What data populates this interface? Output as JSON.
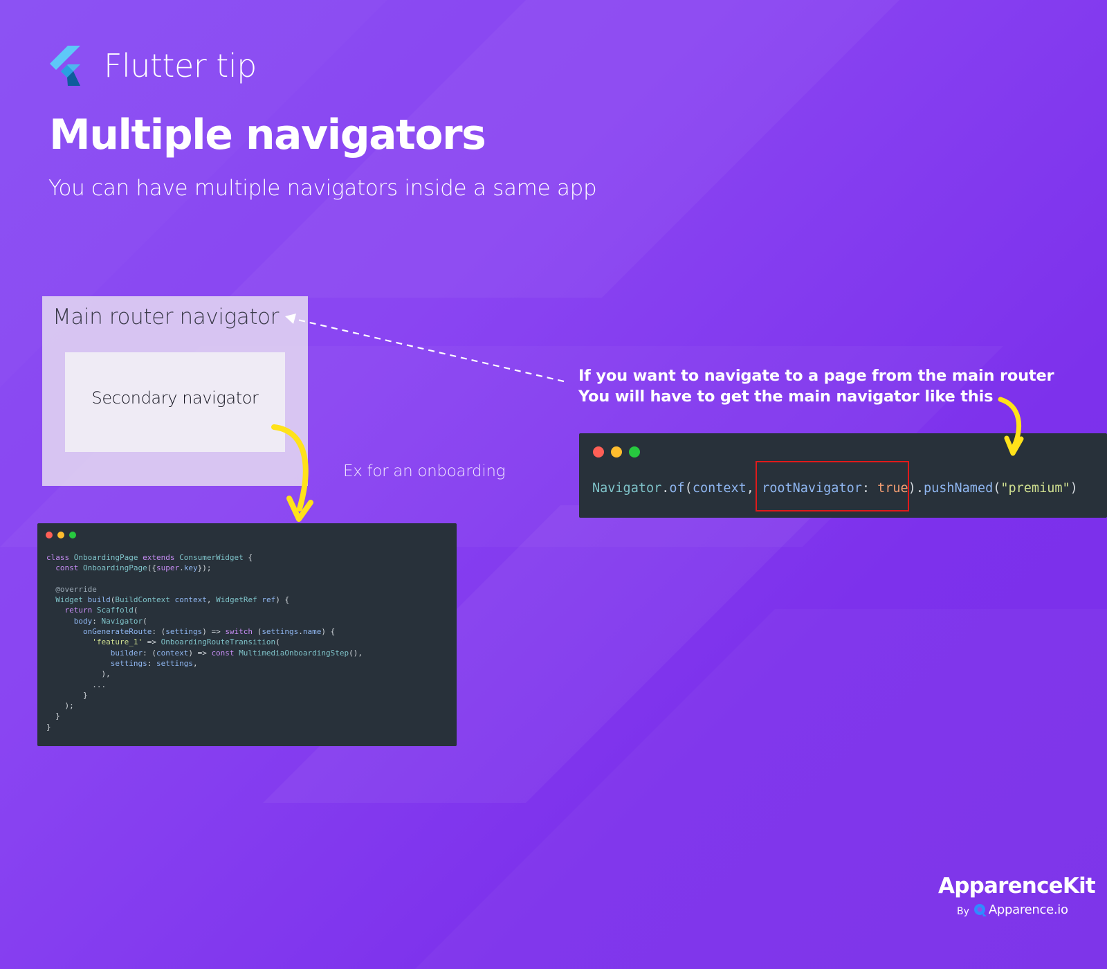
{
  "header": {
    "tip_label": "Flutter tip",
    "logo_icon": "flutter-logo-icon"
  },
  "title": "Multiple navigators",
  "subtitle": "You can have multiple navigators inside a same app",
  "diagram": {
    "main_router_label": "Main router navigator",
    "secondary_label": "Secondary navigator",
    "example_caption": "Ex for an onboarding"
  },
  "instruction": {
    "line1": "If you want to navigate to a page from the main router",
    "line2": "You will have to get the main navigator like this"
  },
  "code_snippet_small": {
    "lines": [
      "class OnboardingPage extends ConsumerWidget {",
      "  const OnboardingPage({super.key});",
      "",
      "  @override",
      "  Widget build(BuildContext context, WidgetRef ref) {",
      "    return Scaffold(",
      "      body: Navigator(",
      "        onGenerateRoute: (settings) => switch (settings.name) {",
      "          'feature_1' => OnboardingRouteTransition(",
      "              builder: (context) => const MultimediaOnboardingStep(),",
      "              settings: settings,",
      "            ),",
      "          ...",
      "        }",
      "    );",
      "  }",
      "}"
    ]
  },
  "code_snippet_large": {
    "code": "Navigator.of(context, rootNavigator: true).pushNamed(\"premium\")"
  },
  "brand": {
    "name": "ApparenceKit",
    "by": "By",
    "company": "Apparence.io",
    "company_icon": "apparence-logo-icon"
  },
  "colors": {
    "background_start": "#8a4ff3",
    "background_end": "#7a2fe9",
    "arrow_yellow": "#ffe21a",
    "code_bg": "#28313a",
    "highlight_red": "#e01a1a"
  }
}
